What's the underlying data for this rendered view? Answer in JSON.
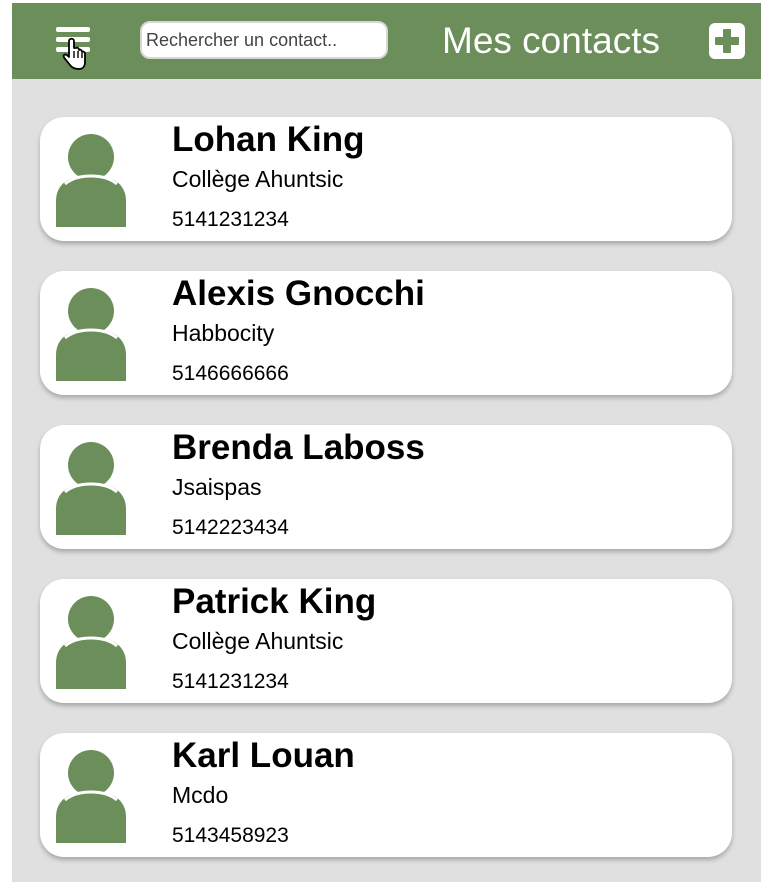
{
  "header": {
    "title": "Mes contacts",
    "menu_icon": "hamburger-menu-icon",
    "add_icon": "plus-square-icon",
    "background": "#6b8e5a"
  },
  "search": {
    "placeholder": "Rechercher un contact..",
    "value": ""
  },
  "contacts": [
    {
      "name": "Lohan King",
      "company": "Collège Ahuntsic",
      "phone": "5141231234"
    },
    {
      "name": "Alexis Gnocchi",
      "company": "Habbocity",
      "phone": "5146666666"
    },
    {
      "name": "Brenda Laboss",
      "company": "Jsaispas",
      "phone": "5142223434"
    },
    {
      "name": "Patrick King",
      "company": "Collège Ahuntsic",
      "phone": "5141231234"
    },
    {
      "name": "Karl Louan",
      "company": "Mcdo",
      "phone": "5143458923"
    }
  ],
  "colors": {
    "accent": "#6b8e5a",
    "background": "#e0e0e0",
    "card": "#ffffff"
  }
}
